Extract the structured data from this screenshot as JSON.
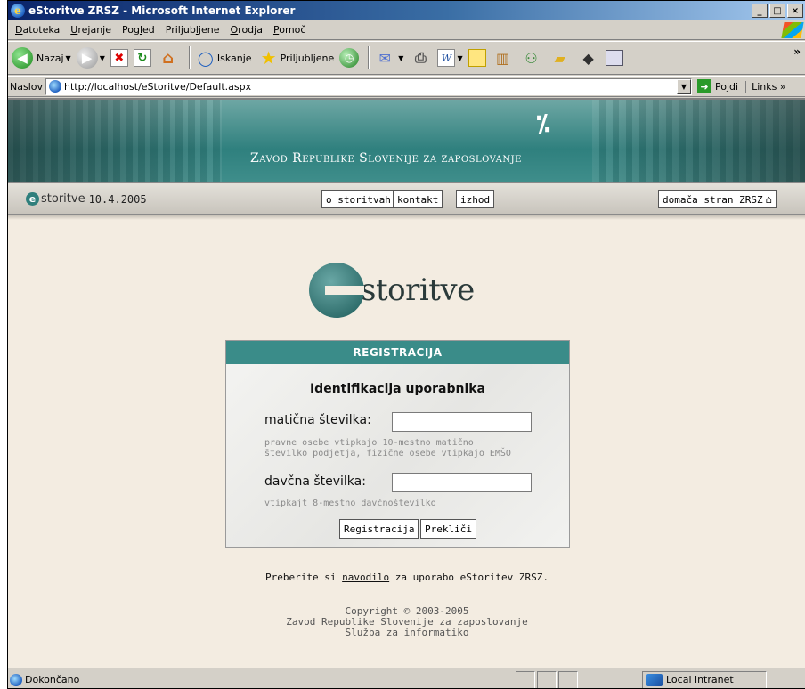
{
  "window": {
    "title": "eStoritve ZRSZ - Microsoft Internet Explorer",
    "controls": [
      "_",
      "□",
      "×"
    ]
  },
  "menu": {
    "items": [
      {
        "label": "Datoteka",
        "key": "D",
        "rest": "atoteka"
      },
      {
        "label": "Urejanje",
        "key": "U",
        "rest": "rejanje"
      },
      {
        "label": "Pogled",
        "pre": "Pog",
        "key": "l",
        "rest": "ed"
      },
      {
        "label": "Priljubljene",
        "pre": "Priljub",
        "key": "l",
        "rest": "jene"
      },
      {
        "label": "Orodja",
        "key": "O",
        "rest": "rodja"
      },
      {
        "label": "Pomoč",
        "key": "P",
        "rest": "omoč"
      }
    ]
  },
  "toolbar": {
    "back_label": "Nazaj",
    "search_label": "Iskanje",
    "favorites_label": "Priljubljene",
    "chevron": "»"
  },
  "address": {
    "label": "Naslov",
    "url": "http://localhost/eStoritve/Default.aspx",
    "go_label": "Pojdi",
    "links_label": "Links",
    "links_chevron": "»"
  },
  "banner": {
    "org_name": "Zavod Republike Slovenije za zaposlovanje"
  },
  "nav": {
    "brand": "storitve",
    "date": "10.4.2005",
    "buttons": {
      "about": "o storitvah",
      "contact": "kontakt",
      "exit": "izhod",
      "home": "domača stran ZRSZ"
    }
  },
  "logo": {
    "text": "storitve"
  },
  "registration": {
    "header": "REGISTRACIJA",
    "subtitle": "Identifikacija uporabnika",
    "reg_number_label": "matična številka:",
    "reg_number_value": "",
    "reg_number_hint_line1": "pravne osebe vtipkajo 10-mestno matično",
    "reg_number_hint_line2": "številko podjetja, fizične osebe vtipkajo EMŠO",
    "tax_number_label": "davčna številka:",
    "tax_number_value": "",
    "tax_number_hint": "vtipkajt 8-mestno davčnoštevilko",
    "submit_label": "Registracija",
    "cancel_label": "Prekliči"
  },
  "instructions": {
    "prefix": "Preberite si",
    "link": "navodilo",
    "suffix": "za uporabo eStoritev ZRSZ."
  },
  "footer": {
    "copyright": "Copyright © 2003-2005",
    "org": "Zavod Republike Slovenije za zaposlovanje",
    "dept": "Služba za informatiko"
  },
  "status": {
    "text": "Dokončano",
    "zone": "Local intranet"
  }
}
